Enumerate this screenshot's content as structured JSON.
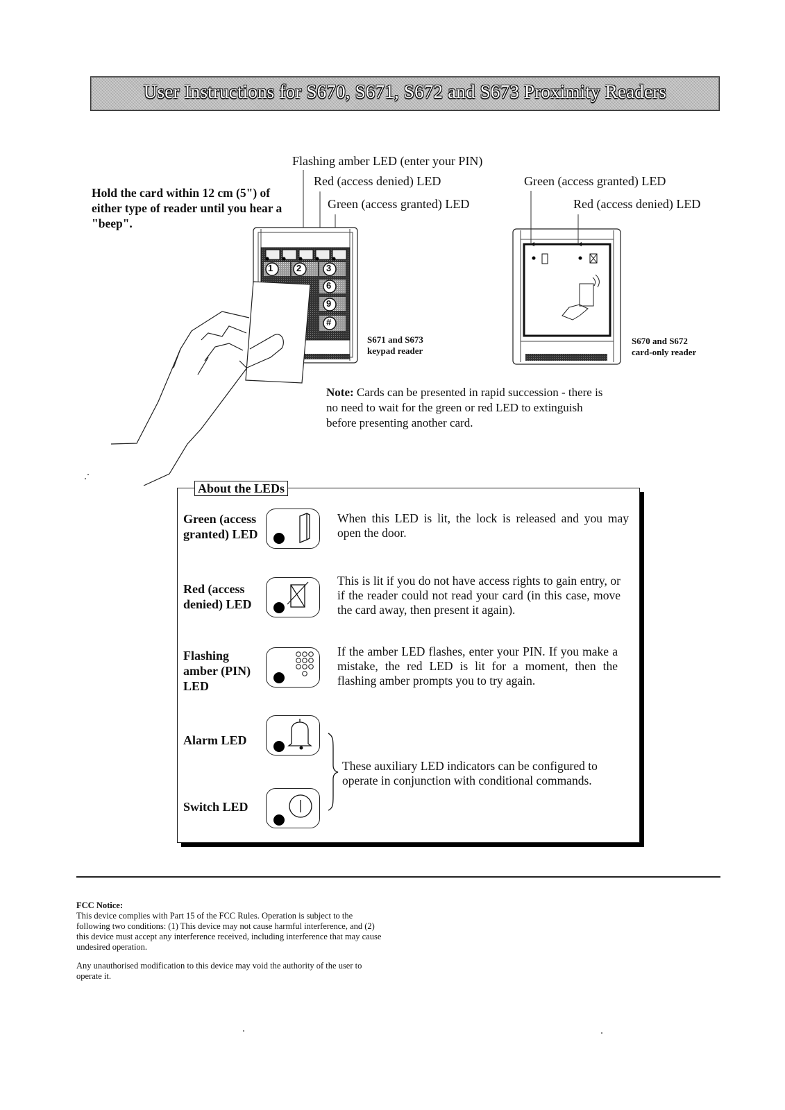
{
  "header": {
    "title": "User Instructions for S670, S671, S672 and S673 Proximity Readers"
  },
  "intro": {
    "text": "Hold the card within 12 cm (5\") of either type of reader until you hear a \"beep\"."
  },
  "keypad_reader": {
    "callouts": {
      "amber": "Flashing amber LED (enter your PIN)",
      "red": "Red (access denied) LED",
      "green": "Green (access granted) LED"
    },
    "keys": [
      "1",
      "2",
      "3",
      "6",
      "9",
      "#"
    ],
    "caption_line1": "S671 and S673",
    "caption_line2": "keypad reader"
  },
  "card_reader": {
    "callouts": {
      "green": "Green (access granted) LED",
      "red": "Red (access denied) LED"
    },
    "caption_line1": "S670 and S672",
    "caption_line2": "card-only reader"
  },
  "note": {
    "label": "Note:",
    "text": " Cards can be presented in rapid succession - there is no need to wait for the green or red LED to extinguish before presenting another card."
  },
  "leds_section": {
    "title": "About the LEDs",
    "items": [
      {
        "label_line1": "Green (access",
        "label_line2": "granted) LED",
        "label_line3": "",
        "icon": "door-icon",
        "description": "When this LED is lit, the lock is released and you may open the door."
      },
      {
        "label_line1": "Red (access",
        "label_line2": "denied) LED",
        "label_line3": "",
        "icon": "crossed-door-icon",
        "description": "This is lit if you do not have access rights to gain entry, or if the reader could not read your card (in this case, move the card away, then present it again)."
      },
      {
        "label_line1": "Flashing",
        "label_line2": "amber (PIN)",
        "label_line3": "LED",
        "icon": "keypad-icon",
        "description": "If the amber LED flashes, enter your PIN. If you make a mistake, the red LED is lit for a moment, then the flashing amber prompts you to try again."
      },
      {
        "label_line1": "Alarm LED",
        "label_line2": "",
        "label_line3": "",
        "icon": "bell-icon",
        "description": ""
      },
      {
        "label_line1": "Switch LED",
        "label_line2": "",
        "label_line3": "",
        "icon": "power-switch-icon",
        "description": ""
      }
    ],
    "auxiliary_note": "These auxiliary LED indicators can be configured to operate in conjunction with conditional commands."
  },
  "fcc": {
    "title": "FCC Notice:",
    "body": "This device complies with Part 15 of the FCC Rules. Operation is subject to the following two conditions: (1) This device may not cause harmful interference, and (2) this device must accept any interference received, including interference that may cause undesired operation.",
    "modification": "Any unauthorised modification to this device may void the authority of the user to operate it."
  }
}
